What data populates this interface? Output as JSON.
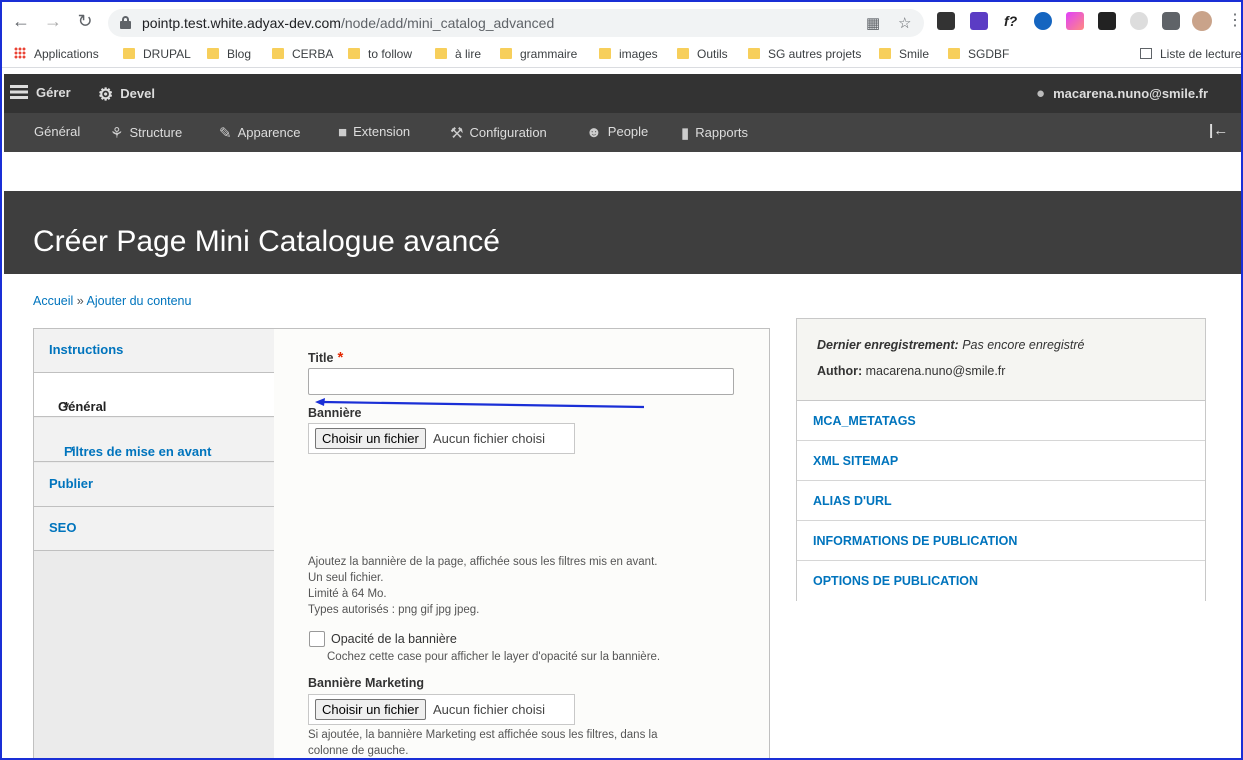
{
  "browser": {
    "url_host": "pointp.test.white.adyax-dev.com",
    "url_path": "/node/add/mini_catalog_advanced",
    "bookmarks": [
      "Applications",
      "DRUPAL",
      "Blog",
      "CERBA",
      "to follow",
      "à lire",
      "grammaire",
      "images",
      "Outils",
      "SG autres projets",
      "Smile",
      "SGDBF"
    ],
    "reading_list": "Liste de lecture"
  },
  "toolbar": {
    "manage": "Gérer",
    "devel": "Devel",
    "user": "macarena.nuno@smile.fr",
    "tray": [
      "Général",
      "Structure",
      "Apparence",
      "Extension",
      "Configuration",
      "People",
      "Rapports"
    ]
  },
  "page": {
    "title": "Créer Page Mini Catalogue avancé",
    "breadcrumb_home": "Accueil",
    "breadcrumb_sep": " » ",
    "breadcrumb_current": "Ajouter du contenu"
  },
  "vtabs": [
    "Instructions",
    "Général",
    "Filtres de mise en avant",
    "Publier",
    "SEO"
  ],
  "form": {
    "title_label": "Title",
    "banner_label": "Bannière",
    "file_button": "Choisir un fichier",
    "file_status": "Aucun fichier choisi",
    "banner_desc": [
      "Ajoutez la bannière de la page, affichée sous les filtres mis en avant.",
      "Un seul fichier.",
      "Limité à 64 Mo.",
      "Types autorisés : png gif jpg jpeg."
    ],
    "opacity_label": "Opacité de la bannière",
    "opacity_desc": "Cochez cette case pour afficher le layer d'opacité sur la bannière.",
    "marketing_label": "Bannière Marketing",
    "marketing_desc": [
      "Si ajoutée, la bannière Marketing est affichée sous les filtres, dans la",
      "colonne de gauche."
    ]
  },
  "meta": {
    "last_saved_label": "Dernier enregistrement:",
    "last_saved_value": "Pas encore enregistré",
    "author_label": "Author:",
    "author_value": "macarena.nuno@smile.fr",
    "items": [
      "MCA_METATAGS",
      "XML SITEMAP",
      "ALIAS D'URL",
      "INFORMATIONS DE PUBLICATION",
      "OPTIONS DE PUBLICATION"
    ]
  },
  "colors": {
    "toolbar": "#333333",
    "tray": "#444444",
    "header": "#3e3e3e",
    "link": "#0074bd",
    "required": "#e32700",
    "annotation": "#1a2fd6"
  },
  "icons": [
    "back-icon",
    "forward-icon",
    "reload-icon",
    "lock-icon",
    "qr-icon",
    "star-icon",
    "extensions-icon",
    "user-icon",
    "gear-icon",
    "hamburger-icon"
  ]
}
